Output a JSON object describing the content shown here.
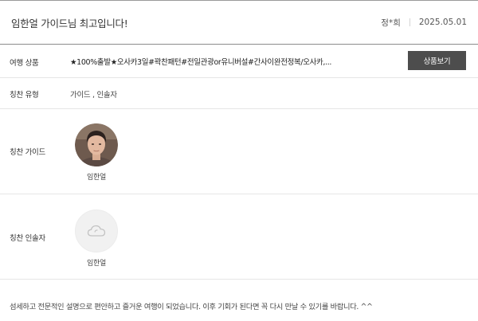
{
  "review": {
    "title": "임한얼 가이드님 최고입니다!",
    "author": "정*희",
    "date": "2025.05.01",
    "body": "섬세하고 전문적인 설명으로 편안하고 즐거운 여행이 되었습니다. 이후 기회가 된다면 꼭 다시 만날 수 있기를 바랍니다. ^^"
  },
  "product": {
    "label": "여행 상품",
    "name": "★100%출발★오사카3일#꽉찬패턴#전일관광or유니버설#간사이완전정복/오사카,...",
    "button_label": "상품보기"
  },
  "praise_type": {
    "label": "칭찬 유형",
    "value": "가이드 , 인솔자"
  },
  "praise_guide": {
    "label": "칭찬 가이드",
    "name": "임한얼",
    "avatar_icon": "profile-photo"
  },
  "praise_leader": {
    "label": "칭찬 인솔자",
    "name": "임한얼",
    "avatar_icon": "cloud-placeholder-icon"
  },
  "colors": {
    "button_bg": "#4d4d4d",
    "placeholder_bg": "#f1f1f1"
  }
}
